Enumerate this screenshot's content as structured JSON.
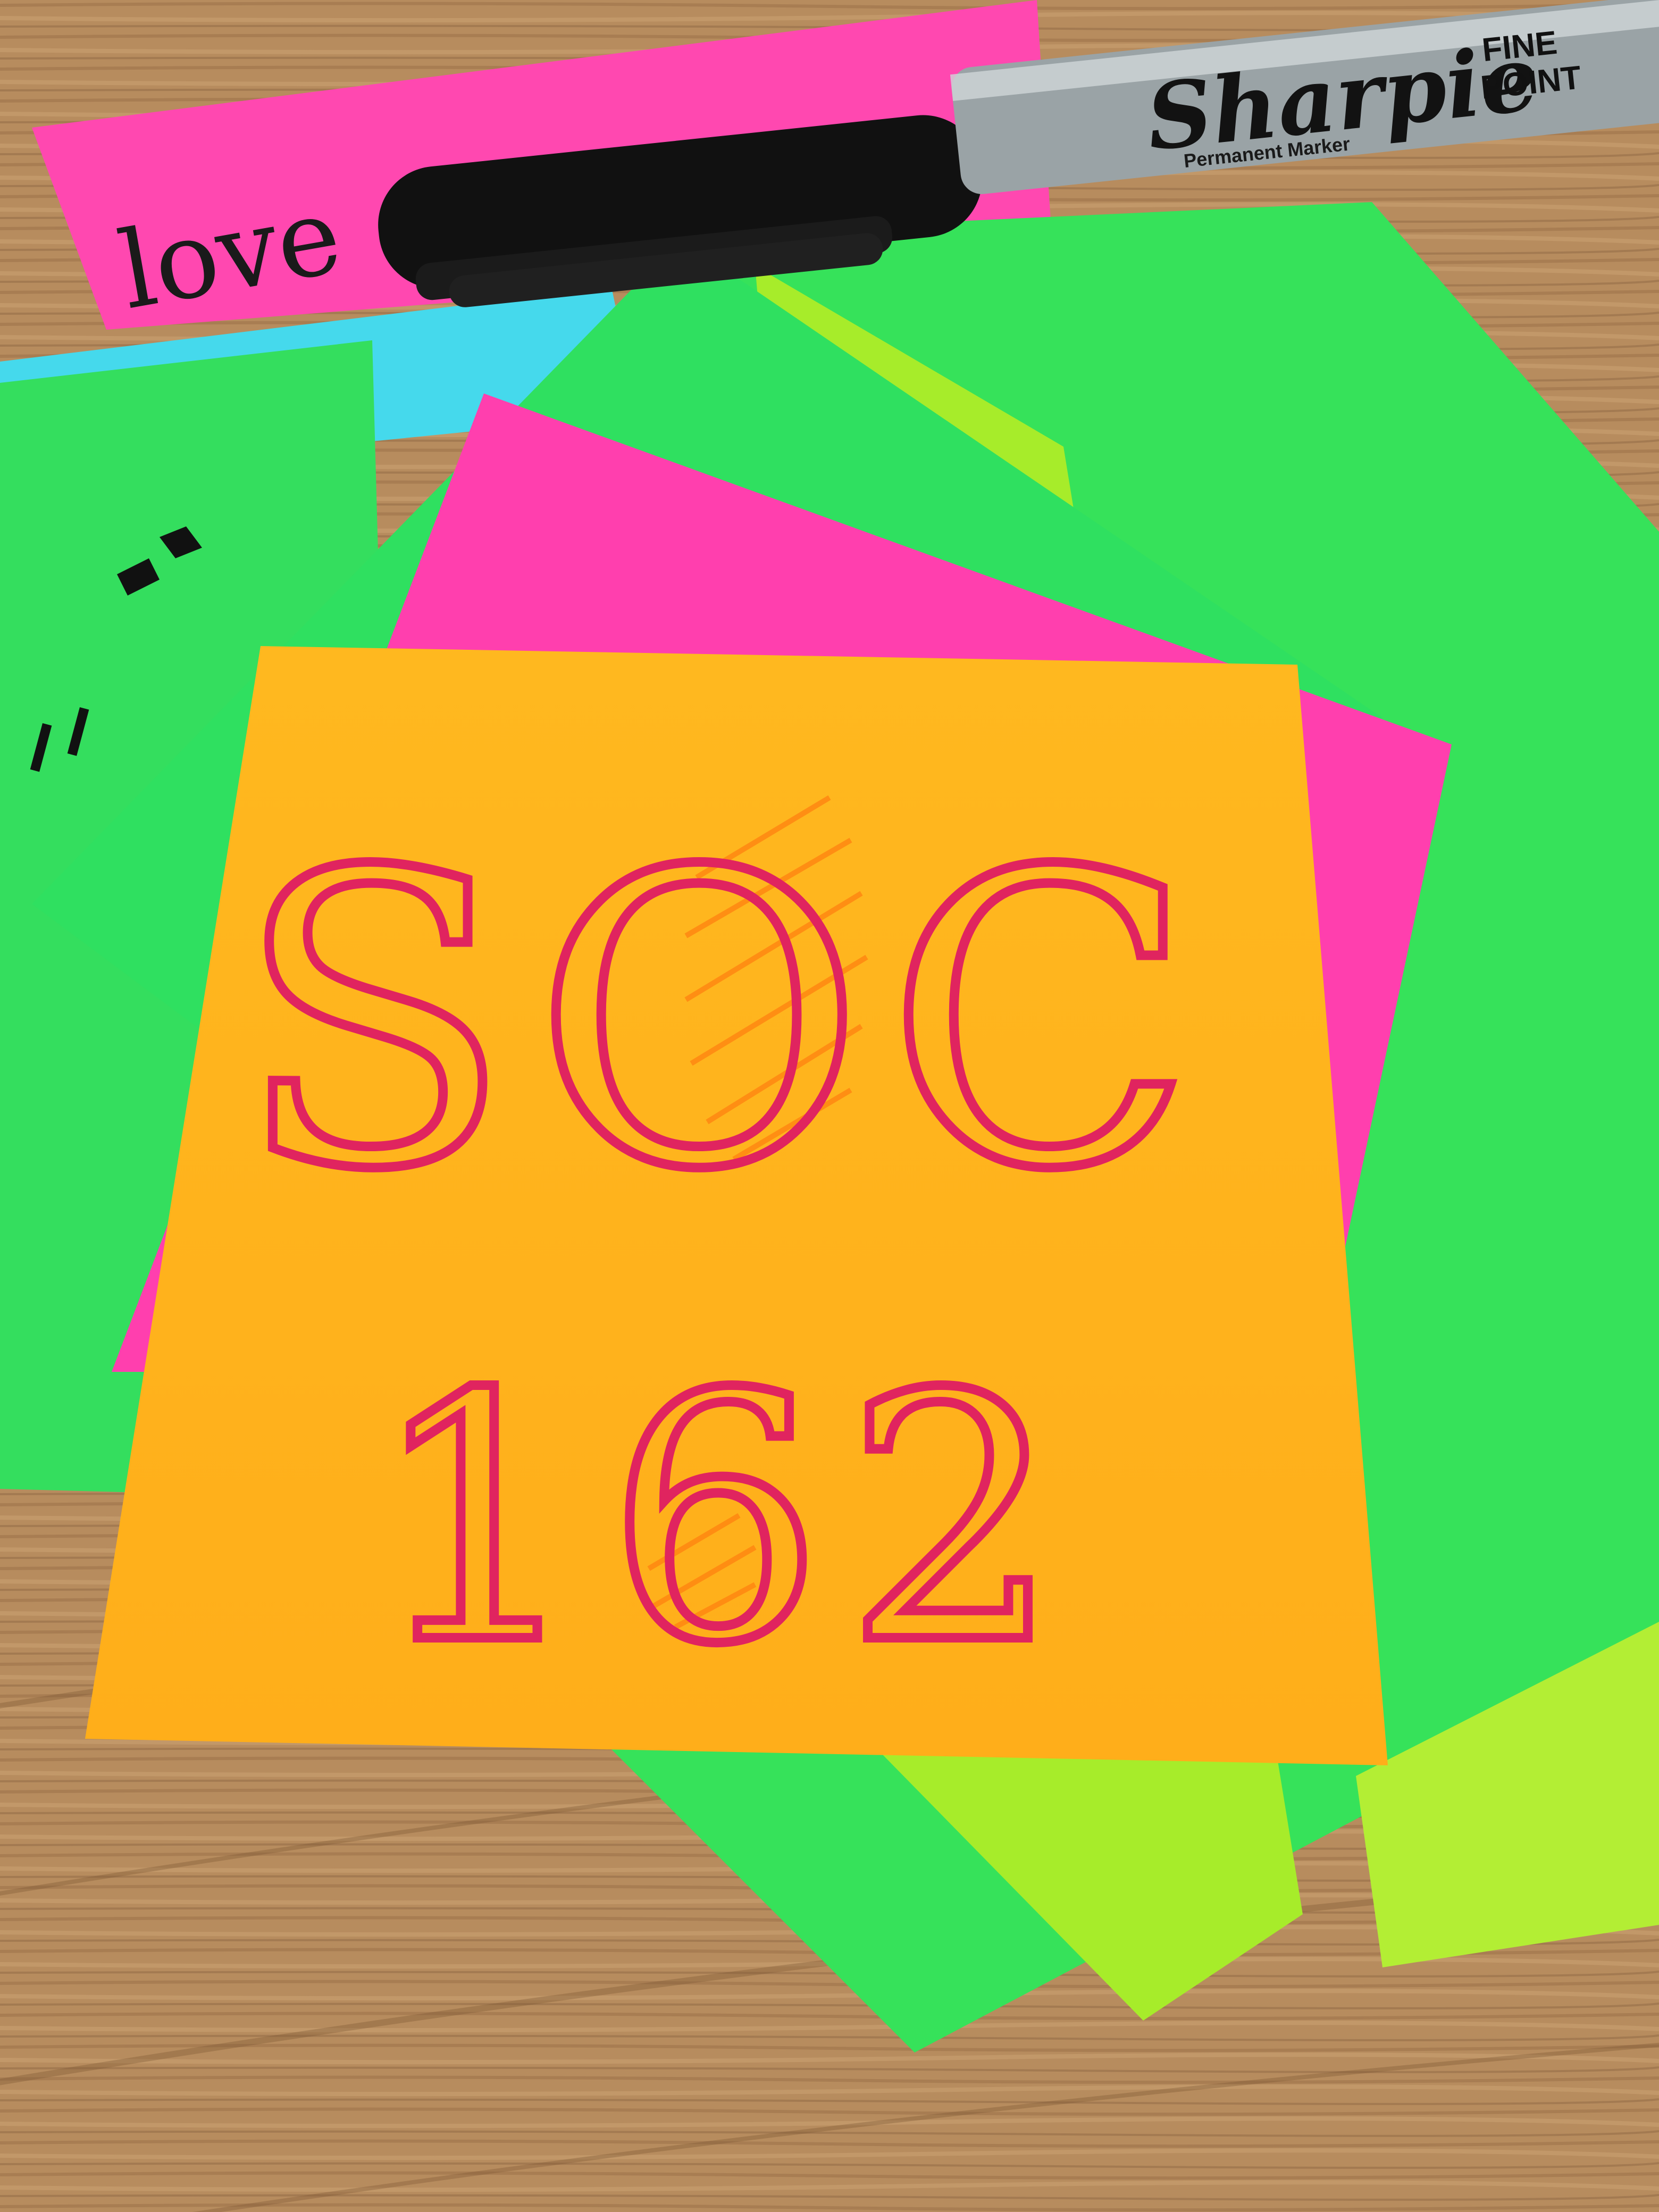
{
  "note": {
    "line1": "SOC",
    "line2": "162"
  },
  "marker": {
    "brand": "Sharpie",
    "finepoint_line1": "FINE",
    "finepoint_line2": "POINT",
    "subtext": "Permanent Marker"
  },
  "background_notes": {
    "pink_note_scribble": "love"
  },
  "colors": {
    "desk": "#b48a5c",
    "orange_note": "#ffb51a",
    "pink_note": "#ff3fae",
    "green_note": "#2fe05a",
    "lime_note": "#a6ee2c",
    "cyan_note": "#44dcee",
    "ink_red": "#e0245f",
    "hatch_orange": "#ff8c14"
  }
}
